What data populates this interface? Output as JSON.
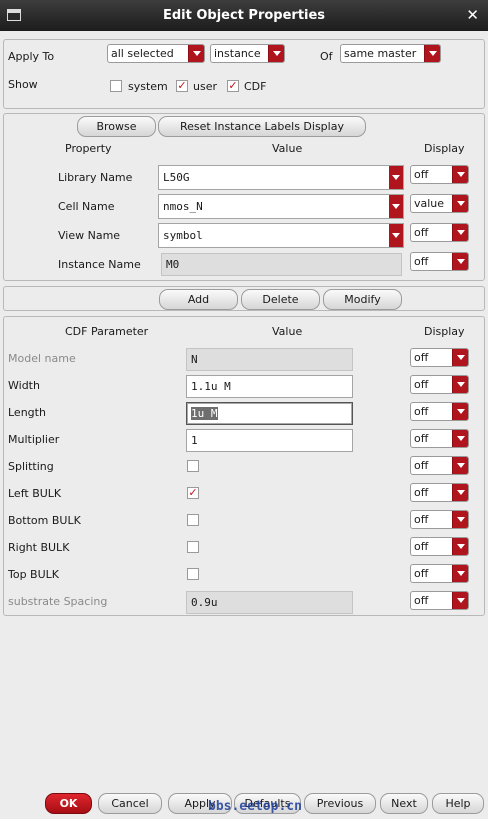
{
  "window": {
    "title": "Edit Object Properties"
  },
  "apply": {
    "apply_to_label": "Apply To",
    "apply_to_value": "all selected",
    "scope_value": "instance",
    "of_label": "Of",
    "of_value": "same master",
    "show_label": "Show",
    "checkboxes": [
      {
        "label": "system",
        "checked": false
      },
      {
        "label": "user",
        "checked": true
      },
      {
        "label": "CDF",
        "checked": true
      }
    ]
  },
  "props": {
    "browse_label": "Browse",
    "reset_label": "Reset Instance Labels Display",
    "col_property": "Property",
    "col_value": "Value",
    "col_display": "Display",
    "rows": [
      {
        "name": "Library Name",
        "value": "L50G",
        "display": "off"
      },
      {
        "name": "Cell Name",
        "value": "nmos_N",
        "display": "value"
      },
      {
        "name": "View Name",
        "value": "symbol",
        "display": "off"
      },
      {
        "name": "Instance Name",
        "value": "M0",
        "display": "off"
      }
    ]
  },
  "actions": {
    "add": "Add",
    "delete": "Delete",
    "modify": "Modify"
  },
  "cdf": {
    "col_param": "CDF Parameter",
    "col_value": "Value",
    "col_display": "Display",
    "rows": [
      {
        "name": "Model name",
        "value": "N",
        "display": "off",
        "enabled": false
      },
      {
        "name": "Width",
        "value": "1.1u M",
        "display": "off"
      },
      {
        "name": "Length",
        "value": "1u M",
        "display": "off",
        "selected": true
      },
      {
        "name": "Multiplier",
        "value": "1",
        "display": "off"
      },
      {
        "name": "Splitting",
        "checked": false,
        "display": "off"
      },
      {
        "name": "Left BULK",
        "checked": true,
        "display": "off"
      },
      {
        "name": "Bottom BULK",
        "checked": false,
        "display": "off"
      },
      {
        "name": "Right BULK",
        "checked": false,
        "display": "off"
      },
      {
        "name": "Top BULK",
        "checked": false,
        "display": "off"
      },
      {
        "name": "substrate Spacing",
        "value": "0.9u",
        "display": "off",
        "enabled": false
      }
    ]
  },
  "footer": {
    "ok": "OK",
    "cancel": "Cancel",
    "apply": "Apply",
    "defaults": "Defaults",
    "previous": "Previous",
    "next": "Next",
    "help": "Help"
  },
  "watermark": "bbs.eetop.cn",
  "icons": {
    "window": "window-icon",
    "close": "close-icon",
    "dropdown": "chevron-down-icon",
    "check": "checkmark-icon"
  },
  "colors": {
    "accent": "#b0141c",
    "titlebar": "#2a2a2a"
  }
}
